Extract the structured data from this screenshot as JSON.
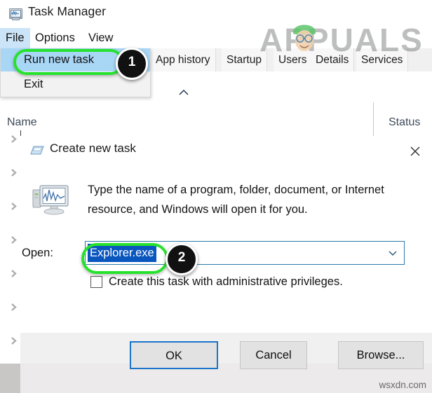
{
  "window": {
    "title": "Task Manager",
    "icon": "task-manager-icon"
  },
  "menubar": {
    "items": [
      {
        "label": "File",
        "active": true
      },
      {
        "label": "Options",
        "active": false
      },
      {
        "label": "View",
        "active": false
      }
    ]
  },
  "file_menu": {
    "items": [
      {
        "label": "Run new task",
        "highlighted": true
      },
      {
        "label": "Exit",
        "highlighted": false
      }
    ]
  },
  "tabs": [
    {
      "label": "App history"
    },
    {
      "label": "Startup"
    },
    {
      "label": "Users"
    },
    {
      "label": "Details"
    },
    {
      "label": "Services"
    }
  ],
  "list": {
    "columns": [
      {
        "label": "Name"
      },
      {
        "label": "Status"
      }
    ],
    "sort_indicator": "chevron-up-icon",
    "row_chevrons": 7
  },
  "dialog": {
    "title": "Create new task",
    "icon": "create-task-icon",
    "close_label": "close-icon",
    "description": "Type the name of a program, folder, document, or Internet resource, and Windows will open it for you.",
    "open_label": "Open:",
    "combo_value": "Explorer.exe",
    "combo_placeholder": "",
    "dropdown_icon": "chevron-down-icon",
    "checkbox": {
      "label": "Create this task with administrative privileges.",
      "checked": false
    },
    "buttons": {
      "ok": "OK",
      "cancel": "Cancel",
      "browse": "Browse..."
    }
  },
  "annotations": {
    "step1": "1",
    "step2": "2",
    "ring_color": "#27e22d",
    "badge_color": "#111111"
  },
  "watermarks": {
    "brand": "APPUALS",
    "bottom": "wsxdn.com"
  },
  "colors": {
    "menu_highlight": "#cce4f7",
    "dropdown_highlight": "#a8d6f5",
    "selection_blue": "#0a56bf",
    "focus_border": "#1b74c8"
  }
}
